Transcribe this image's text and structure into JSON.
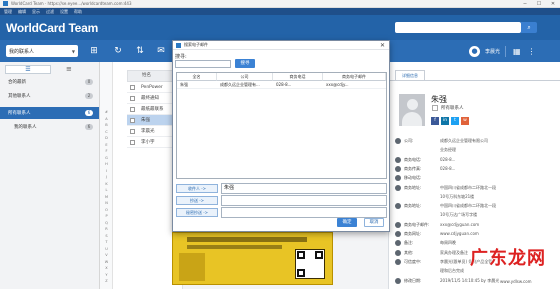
{
  "window": {
    "title": "WorldCard Team · https://se.eyee.../worldcardteam.com:443",
    "min": "─",
    "max": "☐",
    "close": "✕"
  },
  "menu": [
    "管理",
    "编辑",
    "显示",
    "过滤",
    "设置",
    "帮助"
  ],
  "header": {
    "brand": "WorldCard Team",
    "search_placeholder": "",
    "search_icon": "search-icon"
  },
  "toolbar": {
    "select_value": "我的联系人",
    "user_name": "李晨光",
    "icons": [
      "add-card-icon",
      "sync-icon",
      "email-icon",
      "grid-icon",
      "account-icon",
      "more-icon"
    ]
  },
  "sidebar": {
    "tab_label": "☰",
    "items": [
      {
        "label": "合的最新",
        "count": "0"
      },
      {
        "label": "其他联系人",
        "count": "2"
      },
      {
        "label": "所有联系人",
        "count": "6"
      },
      {
        "label": "我的联系人",
        "count": "6"
      }
    ]
  },
  "alphabet": [
    "#",
    "A",
    "B",
    "C",
    "D",
    "E",
    "F",
    "G",
    "H",
    "I",
    "J",
    "K",
    "L",
    "M",
    "N",
    "O",
    "P",
    "Q",
    "R",
    "S",
    "T",
    "U",
    "V",
    "W",
    "X",
    "Y",
    "Z"
  ],
  "list": {
    "header": "姓名",
    "rows": [
      "PenPower",
      "最终通知",
      "最纸最联系",
      "朱强",
      "李晨光",
      "李小宇"
    ],
    "selected_index": 3
  },
  "detail": {
    "tab": "详细信息",
    "name": "朱强",
    "role": "所有联系人",
    "fields": [
      {
        "label": "公司:",
        "value": "成都久远企业管理有限公司"
      },
      {
        "label": "",
        "value": "业务经理"
      },
      {
        "label": "商务电话:",
        "value": "028-8..."
      },
      {
        "label": "商务传真:",
        "value": "028-8..."
      },
      {
        "label": "移动电话:",
        "value": ""
      },
      {
        "label": "商务地址:",
        "value": "中国四川省成都市二环路北一段"
      },
      {
        "label": "",
        "value": "10号万科东坡21楼"
      },
      {
        "label": "商务地址:",
        "value": "中国四川省成都市二环路北一段"
      },
      {
        "label": "",
        "value": "10号万达广场写字楼"
      },
      {
        "label": "商务电子邮件:",
        "value": "xxx@cdjyguan.com"
      },
      {
        "label": "商务网址:",
        "value": "www.cdjyguan.com"
      },
      {
        "label": "备注:",
        "value": "每周四晚"
      },
      {
        "label": "其他:",
        "value": "家具办理及备注"
      },
      {
        "label": "可信度中:",
        "value": "李晨光(跟单员) 条例产品全管"
      },
      {
        "label": "",
        "value": "理和后台完成"
      },
      {
        "label": "修改日期:",
        "value": "2019/11/5 14:10:45 by 李晨光"
      }
    ]
  },
  "dialog": {
    "title": "搜索电子邮件",
    "close": "✕",
    "find_label": "搜寻:",
    "search_button": "搜寻",
    "columns": [
      "全名",
      "公司",
      "商务电话",
      "商务电子邮件"
    ],
    "rows": [
      [
        "朱强",
        "成都久远企业管理有...",
        "028-8...",
        "xxx@cdjy..."
      ]
    ],
    "to_button": "收件人 ->",
    "to_value": "朱强",
    "cc_button": "抄送 ->",
    "cc_value": "",
    "bcc_button": "秘密抄送 ->",
    "bcc_value": "",
    "ok": "确定",
    "cancel": "取消"
  },
  "watermark": {
    "text": "广东龙网",
    "sub": "www.ydlsw.com"
  },
  "colors": {
    "header": "#2363a8",
    "toolbar": "#2c6db5",
    "accent": "#3b82d4",
    "card": "#e8c425"
  }
}
